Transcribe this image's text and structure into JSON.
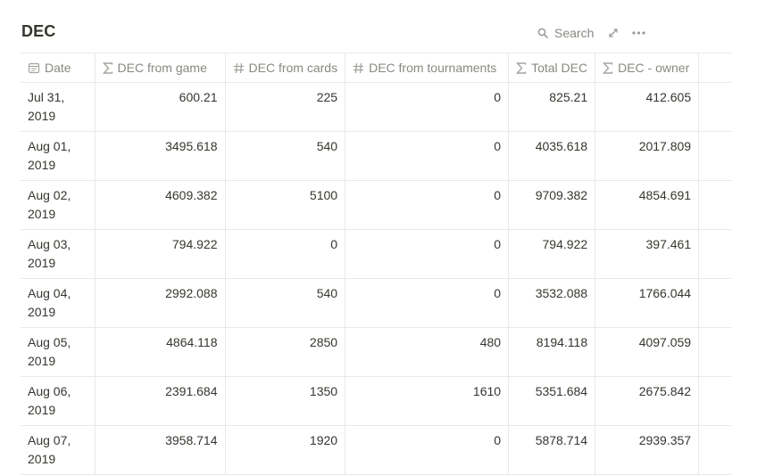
{
  "page": {
    "title": "DEC"
  },
  "toolbar": {
    "search_label": "Search",
    "search_icon": "magnifier-icon",
    "expand_icon": "expand-arrows-icon",
    "more_icon": "ellipsis-icon"
  },
  "table": {
    "columns": [
      {
        "label": "Date",
        "icon": "calendar-icon"
      },
      {
        "label": "DEC from game",
        "icon": "sigma-icon"
      },
      {
        "label": "DEC from cards",
        "icon": "hash-icon"
      },
      {
        "label": "DEC from tournaments",
        "icon": "hash-icon"
      },
      {
        "label": "Total DEC",
        "icon": "sigma-icon"
      },
      {
        "label": "DEC - owner",
        "icon": "sigma-icon"
      }
    ],
    "rows": [
      {
        "date": "Jul 31, 2019",
        "game": "600.21",
        "cards": "225",
        "tournaments": "0",
        "total": "825.21",
        "owner": "412.605"
      },
      {
        "date": "Aug 01, 2019",
        "game": "3495.618",
        "cards": "540",
        "tournaments": "0",
        "total": "4035.618",
        "owner": "2017.809"
      },
      {
        "date": "Aug 02, 2019",
        "game": "4609.382",
        "cards": "5100",
        "tournaments": "0",
        "total": "9709.382",
        "owner": "4854.691"
      },
      {
        "date": "Aug 03, 2019",
        "game": "794.922",
        "cards": "0",
        "tournaments": "0",
        "total": "794.922",
        "owner": "397.461"
      },
      {
        "date": "Aug 04, 2019",
        "game": "2992.088",
        "cards": "540",
        "tournaments": "0",
        "total": "3532.088",
        "owner": "1766.044"
      },
      {
        "date": "Aug 05, 2019",
        "game": "4864.118",
        "cards": "2850",
        "tournaments": "480",
        "total": "8194.118",
        "owner": "4097.059"
      },
      {
        "date": "Aug 06, 2019",
        "game": "2391.684",
        "cards": "1350",
        "tournaments": "1610",
        "total": "5351.684",
        "owner": "2675.842"
      },
      {
        "date": "Aug 07, 2019",
        "game": "3958.714",
        "cards": "1920",
        "tournaments": "0",
        "total": "5878.714",
        "owner": "2939.357"
      }
    ]
  }
}
